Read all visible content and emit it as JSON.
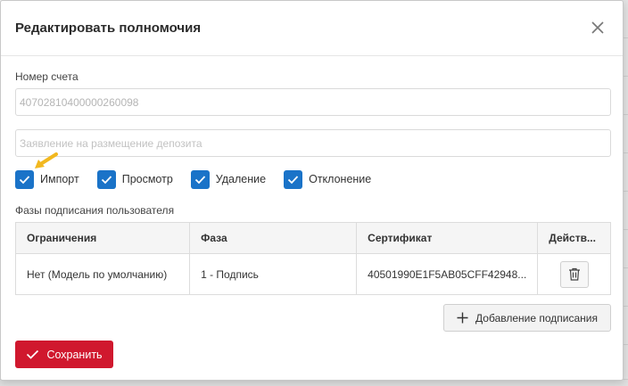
{
  "modal": {
    "title": "Редактировать полномочия",
    "close_icon": "close-icon"
  },
  "account": {
    "label": "Номер счета",
    "value": "40702810400000260098"
  },
  "document": {
    "placeholder": "Заявление на размещение депозита"
  },
  "permissions": [
    {
      "label": "Импорт",
      "checked": true
    },
    {
      "label": "Просмотр",
      "checked": true
    },
    {
      "label": "Удаление",
      "checked": true
    },
    {
      "label": "Отклонение",
      "checked": true
    }
  ],
  "phases": {
    "label": "Фазы подписания пользователя",
    "columns": [
      "Ограничения",
      "Фаза",
      "Сертификат",
      "Действ..."
    ],
    "rows": [
      {
        "restriction": "Нет (Модель по умолчанию)",
        "phase": "1 - Подпись",
        "certificate": "40501990E1F5AB05CFF42948...",
        "action_icon": "trash-icon"
      }
    ]
  },
  "actions": {
    "add_label": "Добавление подписания",
    "save_label": "Сохранить"
  },
  "colors": {
    "accent": "#1a73c8",
    "primary_button": "#d0182e",
    "annotation_arrow": "#f2b81f"
  }
}
